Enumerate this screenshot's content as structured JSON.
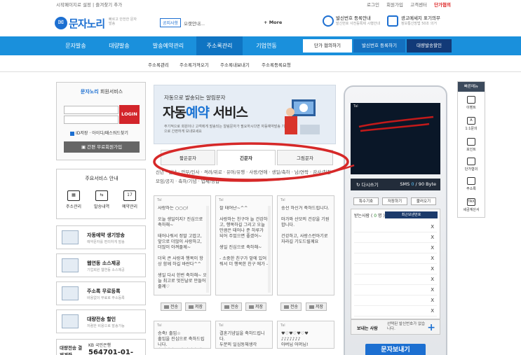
{
  "util": {
    "left": "시작페이지로 설정 | 즐겨찾기 추가",
    "links": [
      "로그인",
      "회원가입",
      "고객센터"
    ],
    "highlight": "단가협의"
  },
  "header": {
    "logo": "문자노리",
    "logo_sub": "빠르고 안전한 문자발송",
    "notice_tag": "공지사항",
    "notice_text": "오랫안내...",
    "more": "+ More",
    "link1_title": "발신번호 등록안내",
    "link1_sub": "발신번호 사전등록제 시행안내",
    "link2_title": "광고메세지 표기의무",
    "link2_sub": "정보통신망법 50조 의거"
  },
  "nav": {
    "items": [
      "문자발송",
      "대량발송",
      "발송예약관리",
      "주소록관리",
      "기업연동"
    ],
    "right_buttons": [
      "단가 협의하기",
      "발신번호 등록하기",
      "대량발송할인"
    ]
  },
  "subnav": [
    "주소록관리",
    "주소록가져오기",
    "주소록내보내기",
    "주소록등록요청"
  ],
  "login": {
    "title_brand": "문자노리",
    "title_rest": " 회원서비스",
    "button": "LOGIN",
    "remember": "ID저장 · 아이디/패스워드찾기",
    "join": "간편 무료회원가입"
  },
  "services": {
    "title": "주요서비스 안내",
    "icons": [
      {
        "label": "주소관리",
        "icon": "address-book-icon"
      },
      {
        "label": "발송내역",
        "icon": "send-history-icon"
      },
      {
        "label": "예약관리",
        "icon": "calendar-icon",
        "glyph": "17"
      }
    ],
    "items": [
      {
        "title": "자동예약 생기방송",
        "sub": "예약문자를 편리하게 발송",
        "icon": "auto-reserve-icon"
      },
      {
        "title": "웹연동 소스제공",
        "sub": "기업회원 웹연동 소스제공",
        "icon": "web-source-icon"
      },
      {
        "title": "주소록 무료등록",
        "sub": "바용없이 무료로 주소등록",
        "icon": "address-register-icon"
      },
      {
        "title": "대량전송 할인",
        "sub": "저렴한 비용으로 발송가능",
        "icon": "mail-icon"
      }
    ],
    "bank_label": "대량전송 결제계좌",
    "bank_name": "KB 국민은행",
    "bank_no": "564701-01-544307"
  },
  "banner": {
    "small": "자동으로 발송되는 알림문자",
    "big_pre": "자동",
    "big_em": "예약",
    "big_post": " 서비스",
    "desc": "주기적으로 회원이나 고객에게 발송되는 알림문자가 필요하시다면 자동예약발송 기능으로 간편하게 보내보세요"
  },
  "tabs": [
    "짧은문자",
    "긴문자",
    "그림문자"
  ],
  "categories": "신년 · 설날 · 안부/인사 · 격려/위로 · 유머/유행 · 사랑/연애 · 생일/축하 · 남/연락 · 감사/칭찬 · 모임/공지 · 축하/기념 · 업체/영업",
  "messages": [
    {
      "label": "Tal",
      "text": "사랑하는 ○○○!\n\n오늘 생일이지? 진심으로 축하해~\n\n태어나줘서 정말 고맙고, 앞으로 더많이 사랑하고, 더많이 아껴줄께~\n\n더욱 큰 사랑과 행복이 항상 함께 하길 바란다^^\n\n생일 다시 한번 축하해~ 오늘 최고로 멋진날로 만들어줄께♡"
    },
    {
      "label": "Tal",
      "text": "잘 태어난~^^\n\n사랑하는 친구야 늘 건강하고, 행복하길 그리고 오늘만큼은 태어나 준 하루가 되어 주었으면 좋겠어~\n\n생일 진심으로 축하해~\n\n- 소중한 친구가 앞에 있어줘서 더 행복한 친구 에가 -"
    },
    {
      "label": "Tal",
      "text": "송선 하신거 축하드립니다.\n\n마가와 산모의 건강을 기원합니다.\n\n건강하고, 사랑스런아기로 자라길 기도드릴께요"
    }
  ],
  "messages2": [
    {
      "label": "Tal",
      "text": "승축! 출입☆\n출입을 진심으로 축하드립니다.\n출입이란 끝이 아니라 새"
    },
    {
      "label": "Tal",
      "text": "결혼기념일을 축하드립니다.\n두분의 일심동체생각"
    },
    {
      "label": "Tal",
      "text": "♥♡♥♡♥♡♥\n♪♪♪♪♪♪♪\n아버님 어머님!"
    }
  ],
  "actions": {
    "send": "전송",
    "save": "저장"
  },
  "phone": {
    "status": "Tal",
    "reset": "다시쓰기",
    "sms_label": "SMS",
    "count": "0",
    "limit": "/ 90 Byte",
    "buttons": [
      "특수기호",
      "저장하기",
      "불러오기"
    ],
    "recv_label": "받는사람",
    "recv_count": "0",
    "recv_unit": "명",
    "recent": "최근보낸번호",
    "x": "X",
    "sender_label": "보내는 사람",
    "sender_hint": "선택된 발신번호가 없습니다.",
    "send_button": "문자보내기"
  },
  "quick": {
    "title": "빠른메뉴",
    "items": [
      {
        "label": "이벤트",
        "icon": "event-icon"
      },
      {
        "label": "1:1문의",
        "icon": "inquiry-icon",
        "glyph": "A"
      },
      {
        "label": "포인트",
        "icon": "point-icon"
      },
      {
        "label": "단가협의",
        "icon": "price-icon"
      },
      {
        "label": "주소록",
        "icon": "contact-icon"
      },
      {
        "label": "세금계산서",
        "icon": "tax-icon",
        "glyph": "TAX"
      }
    ]
  },
  "colors": {
    "brand": "#1c6fd1",
    "nav": "#1a90dc",
    "login": "#d3252b",
    "annotation": "#d62828"
  }
}
